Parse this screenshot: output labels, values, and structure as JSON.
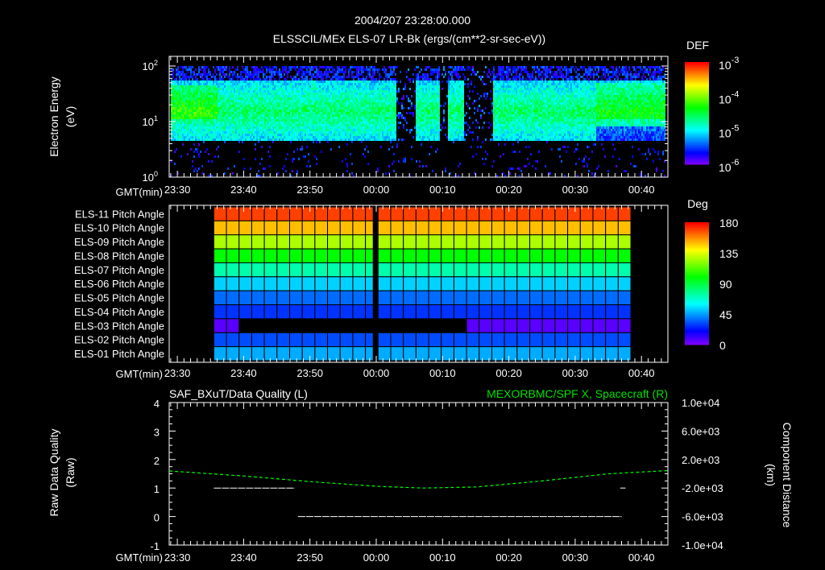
{
  "title": "2004/207 23:28:00.000",
  "chart_data": [
    {
      "type": "heatmap",
      "title": "ELSSCIL/MEx ELS-07 LR-Bk  (ergs/(cm**2-sr-sec-eV))",
      "ylabel": "Electron Energy",
      "ylabel_units": "(eV)",
      "xlabel": "GMT(min)",
      "x_ticks": [
        "23:30",
        "23:40",
        "23:50",
        "00:00",
        "00:10",
        "00:20",
        "00:30",
        "00:40"
      ],
      "x_tick_minutes": [
        -30,
        -20,
        -10,
        0,
        10,
        20,
        30,
        40
      ],
      "xlim_minutes": [
        -31.2,
        44
      ],
      "y_scale": "log",
      "ylim": [
        1,
        145
      ],
      "y_ticks": [
        {
          "base": "10",
          "exp": "0",
          "value": 1
        },
        {
          "base": "10",
          "exp": "1",
          "value": 10
        },
        {
          "base": "10",
          "exp": "2",
          "value": 100
        }
      ],
      "filled_energy_range_eV": [
        4.5,
        145
      ],
      "data_gaps_minutes": [
        [
          2.8,
          5.8
        ],
        [
          9.5,
          10.8
        ],
        [
          13.2,
          17.6
        ]
      ],
      "colorbar": {
        "label": "DEF",
        "scale": "log",
        "range": [
          -6,
          -3
        ],
        "ticks": [
          {
            "base": "10",
            "exp": "-3"
          },
          {
            "base": "10",
            "exp": "-4"
          },
          {
            "base": "10",
            "exp": "-5"
          },
          {
            "base": "10",
            "exp": "-6"
          }
        ]
      }
    },
    {
      "type": "heatmap",
      "xlabel": "GMT(min)",
      "x_ticks": [
        "23:30",
        "23:40",
        "23:50",
        "00:00",
        "00:10",
        "00:20",
        "00:30",
        "00:40"
      ],
      "data_range_minutes": [
        -24.5,
        38.4
      ],
      "gap_minutes": [
        -0.4,
        0.4
      ],
      "rows": [
        {
          "label": "ELS-11 Pitch Angle",
          "value": 170
        },
        {
          "label": "ELS-10 Pitch Angle",
          "value": 150
        },
        {
          "label": "ELS-09 Pitch Angle",
          "value": 127
        },
        {
          "label": "ELS-08 Pitch Angle",
          "value": 100
        },
        {
          "label": "ELS-07 Pitch Angle",
          "value": 73
        },
        {
          "label": "ELS-06 Pitch Angle",
          "value": 53
        },
        {
          "label": "ELS-05 Pitch Angle",
          "value": 37
        },
        {
          "label": "ELS-04 Pitch Angle",
          "value": 28
        },
        {
          "label": "ELS-03 Pitch Angle",
          "value": 6,
          "missing_minutes": [
            -20.8,
            13.5
          ]
        },
        {
          "label": "ELS-02 Pitch Angle",
          "value": 32
        },
        {
          "label": "ELS-01 Pitch Angle",
          "value": 47
        }
      ],
      "colorbar": {
        "label": "Deg",
        "range": [
          0,
          180
        ],
        "ticks": [
          "180",
          "135",
          "90",
          "45",
          "0"
        ]
      }
    },
    {
      "type": "line",
      "title_left": "SAF_BXuT/Data Quality (L)",
      "title_right": "MEXORBMC/SPF X, Spacecraft (R)",
      "ylabel_left": "Raw Data Quality",
      "ylabel_left_units": "(Raw)",
      "ylabel_right": "Component Distance",
      "ylabel_right_units": "(km)",
      "xlabel": "GMT(min)",
      "x_ticks": [
        "23:30",
        "23:40",
        "23:50",
        "00:00",
        "00:10",
        "00:20",
        "00:30",
        "00:40"
      ],
      "ylim_left": [
        -1,
        4
      ],
      "y_ticks_left": [
        "4",
        "3",
        "2",
        "1",
        "0",
        "-1"
      ],
      "ylim_right": [
        -10000,
        10000
      ],
      "y_ticks_right": [
        "1.0e+04",
        "6.0e+03",
        "2.0e+03",
        "-2.0e+03",
        "-6.0e+03",
        "-1.0e+04"
      ],
      "series": [
        {
          "name": "Data Quality",
          "axis": "left",
          "color": "#ffffff",
          "segments": [
            {
              "x": [
                -24.5,
                -12.3
              ],
              "y": 1
            },
            {
              "x": [
                -11.8,
                37.0
              ],
              "y": 0
            },
            {
              "x": [
                36.8,
                37.6
              ],
              "y": 1
            }
          ]
        },
        {
          "name": "SPF X",
          "axis": "right",
          "color": "#00ff00",
          "style": "dashed",
          "x": [
            -31.2,
            -20,
            -10,
            0,
            7,
            15,
            25,
            35,
            44
          ],
          "y": [
            400,
            -300,
            -1100,
            -1750,
            -2000,
            -1850,
            -1000,
            0,
            450
          ]
        }
      ]
    }
  ]
}
